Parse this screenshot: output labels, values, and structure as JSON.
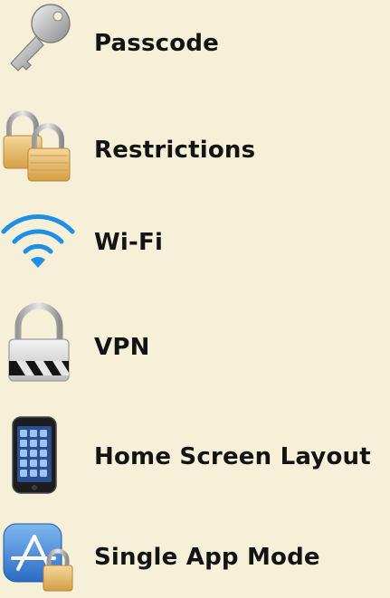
{
  "settings_list": {
    "items": [
      {
        "label": "Passcode",
        "icon": "key-icon"
      },
      {
        "label": "Restrictions",
        "icon": "padlocks-icon"
      },
      {
        "label": "Wi-Fi",
        "icon": "wifi-icon"
      },
      {
        "label": "VPN",
        "icon": "vpn-lock-icon"
      },
      {
        "label": "Home Screen Layout",
        "icon": "iphone-icon"
      },
      {
        "label": "Single App Mode",
        "icon": "app-store-lock-icon"
      }
    ]
  },
  "colors": {
    "background": "#f6f0d8",
    "text": "#141414",
    "wifi_blue": "#1f8fe6",
    "lock_gold": "#e2b25a",
    "lock_silver": "#c9c9c9"
  }
}
